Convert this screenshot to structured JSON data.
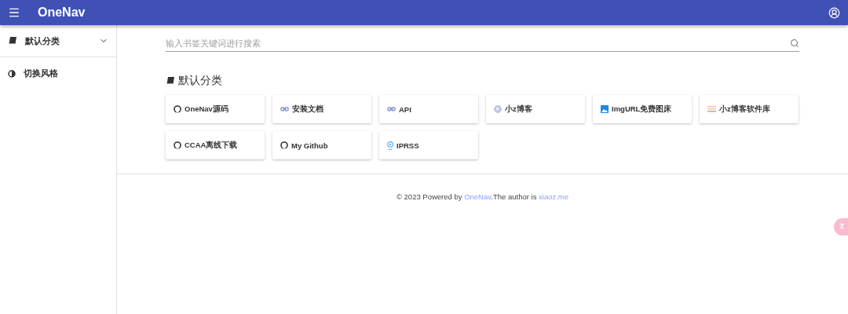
{
  "app_bar": {
    "title": "OneNav"
  },
  "sidebar": {
    "items": [
      {
        "label": "默认分类",
        "kind": "book",
        "expanded": false
      },
      {
        "label": "切换风格",
        "kind": "contrast"
      }
    ]
  },
  "search": {
    "placeholder": "输入书签关键词进行搜索"
  },
  "category": {
    "title": "默认分类",
    "links": [
      {
        "label": "OneNav源码",
        "kind": "github"
      },
      {
        "label": "安装文档",
        "kind": "link"
      },
      {
        "label": "API",
        "kind": "link"
      },
      {
        "label": "小z博客",
        "kind": "globe"
      },
      {
        "label": "ImgURL免费图床",
        "kind": "image"
      },
      {
        "label": "小z博客软件库",
        "kind": "bars"
      },
      {
        "label": "CCAA离线下载",
        "kind": "github"
      },
      {
        "label": "My Github",
        "kind": "github"
      },
      {
        "label": "IPRSS",
        "kind": "badge"
      }
    ]
  },
  "footer": {
    "prefix": "© 2023 Powered by ",
    "link1": "OneNav",
    "middle": ".The author is ",
    "link2": "xiaoz.me"
  }
}
